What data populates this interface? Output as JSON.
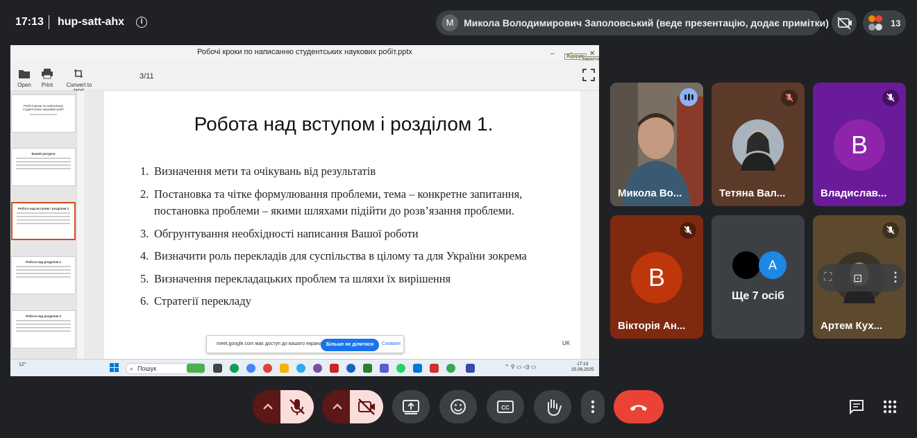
{
  "topbar": {
    "time": "17:13",
    "meeting_code": "hup-satt-ahx",
    "presenter_initial": "М",
    "presenter_text": "Микола Володимирович Заполовський (веде презентацію, додає примітки)",
    "participant_count": "13"
  },
  "share_window": {
    "title": "Робочі кроки по написанню студентських наукових робіт.pptx",
    "tooltip": "Відкриті",
    "tooltip2": "Закрити",
    "toolbar": {
      "open": "Open",
      "print": "Print",
      "convert": "Convert to PDF",
      "page": "3/11"
    },
    "thumbnails": [
      {
        "title": "Робочі кроки по написанню студентських наукових робіт"
      },
      {
        "title": "Базові ресурси"
      },
      {
        "title": "Робота над вступом і розділом 1"
      },
      {
        "title": "Робота над розділом 2"
      },
      {
        "title": "Робота над розділом 3"
      }
    ],
    "slide": {
      "title": "Робота над вступом і розділом 1.",
      "items": [
        {
          "num": "1.",
          "text": "Визначення мети та очікувань від результатів"
        },
        {
          "num": "2.",
          "text": "Постановка та чітке формулювання проблеми, тема – конкретне запитання, постановка проблеми – якими шляхами підійти до розв’язання проблеми."
        },
        {
          "num": "3.",
          "text": "Обгрунтування необхідності написання Вашої роботи"
        },
        {
          "num": "4.",
          "text": "Визначити роль перекладів для суспільства в цілому та для України зокрема"
        },
        {
          "num": "5.",
          "text": "Визначення перекладацьких проблем та шляхи їх вирішення"
        },
        {
          "num": "6.",
          "text": "Стратегії перекладу"
        }
      ]
    },
    "notification": {
      "message": "meet.google.com має доступ до вашого екрана.",
      "stop_sharing": "Більше не ділитися",
      "hide": "Сховати"
    },
    "lang": "UK",
    "taskbar": {
      "search": "Пошук",
      "time": "17:13",
      "date": "25.09.2025",
      "weather": "12°"
    }
  },
  "participants": [
    {
      "name": "Микола Во...",
      "speaking": true
    },
    {
      "name": "Тетяна Вал...",
      "muted": true
    },
    {
      "name": "Владислав...",
      "initial": "В",
      "muted": true,
      "color": "#8e24aa"
    },
    {
      "name": "Вікторія Ан...",
      "initial": "В",
      "muted": true,
      "color": "#bf360c"
    },
    {
      "name": "Ще 7 осіб",
      "initial2": "А"
    },
    {
      "name": "Артем Кух...",
      "muted": true
    }
  ],
  "colors": {
    "background": "#202124",
    "accent": "#8ab4f8",
    "end_call": "#ea4335",
    "muted_red": "#f9dedc"
  }
}
